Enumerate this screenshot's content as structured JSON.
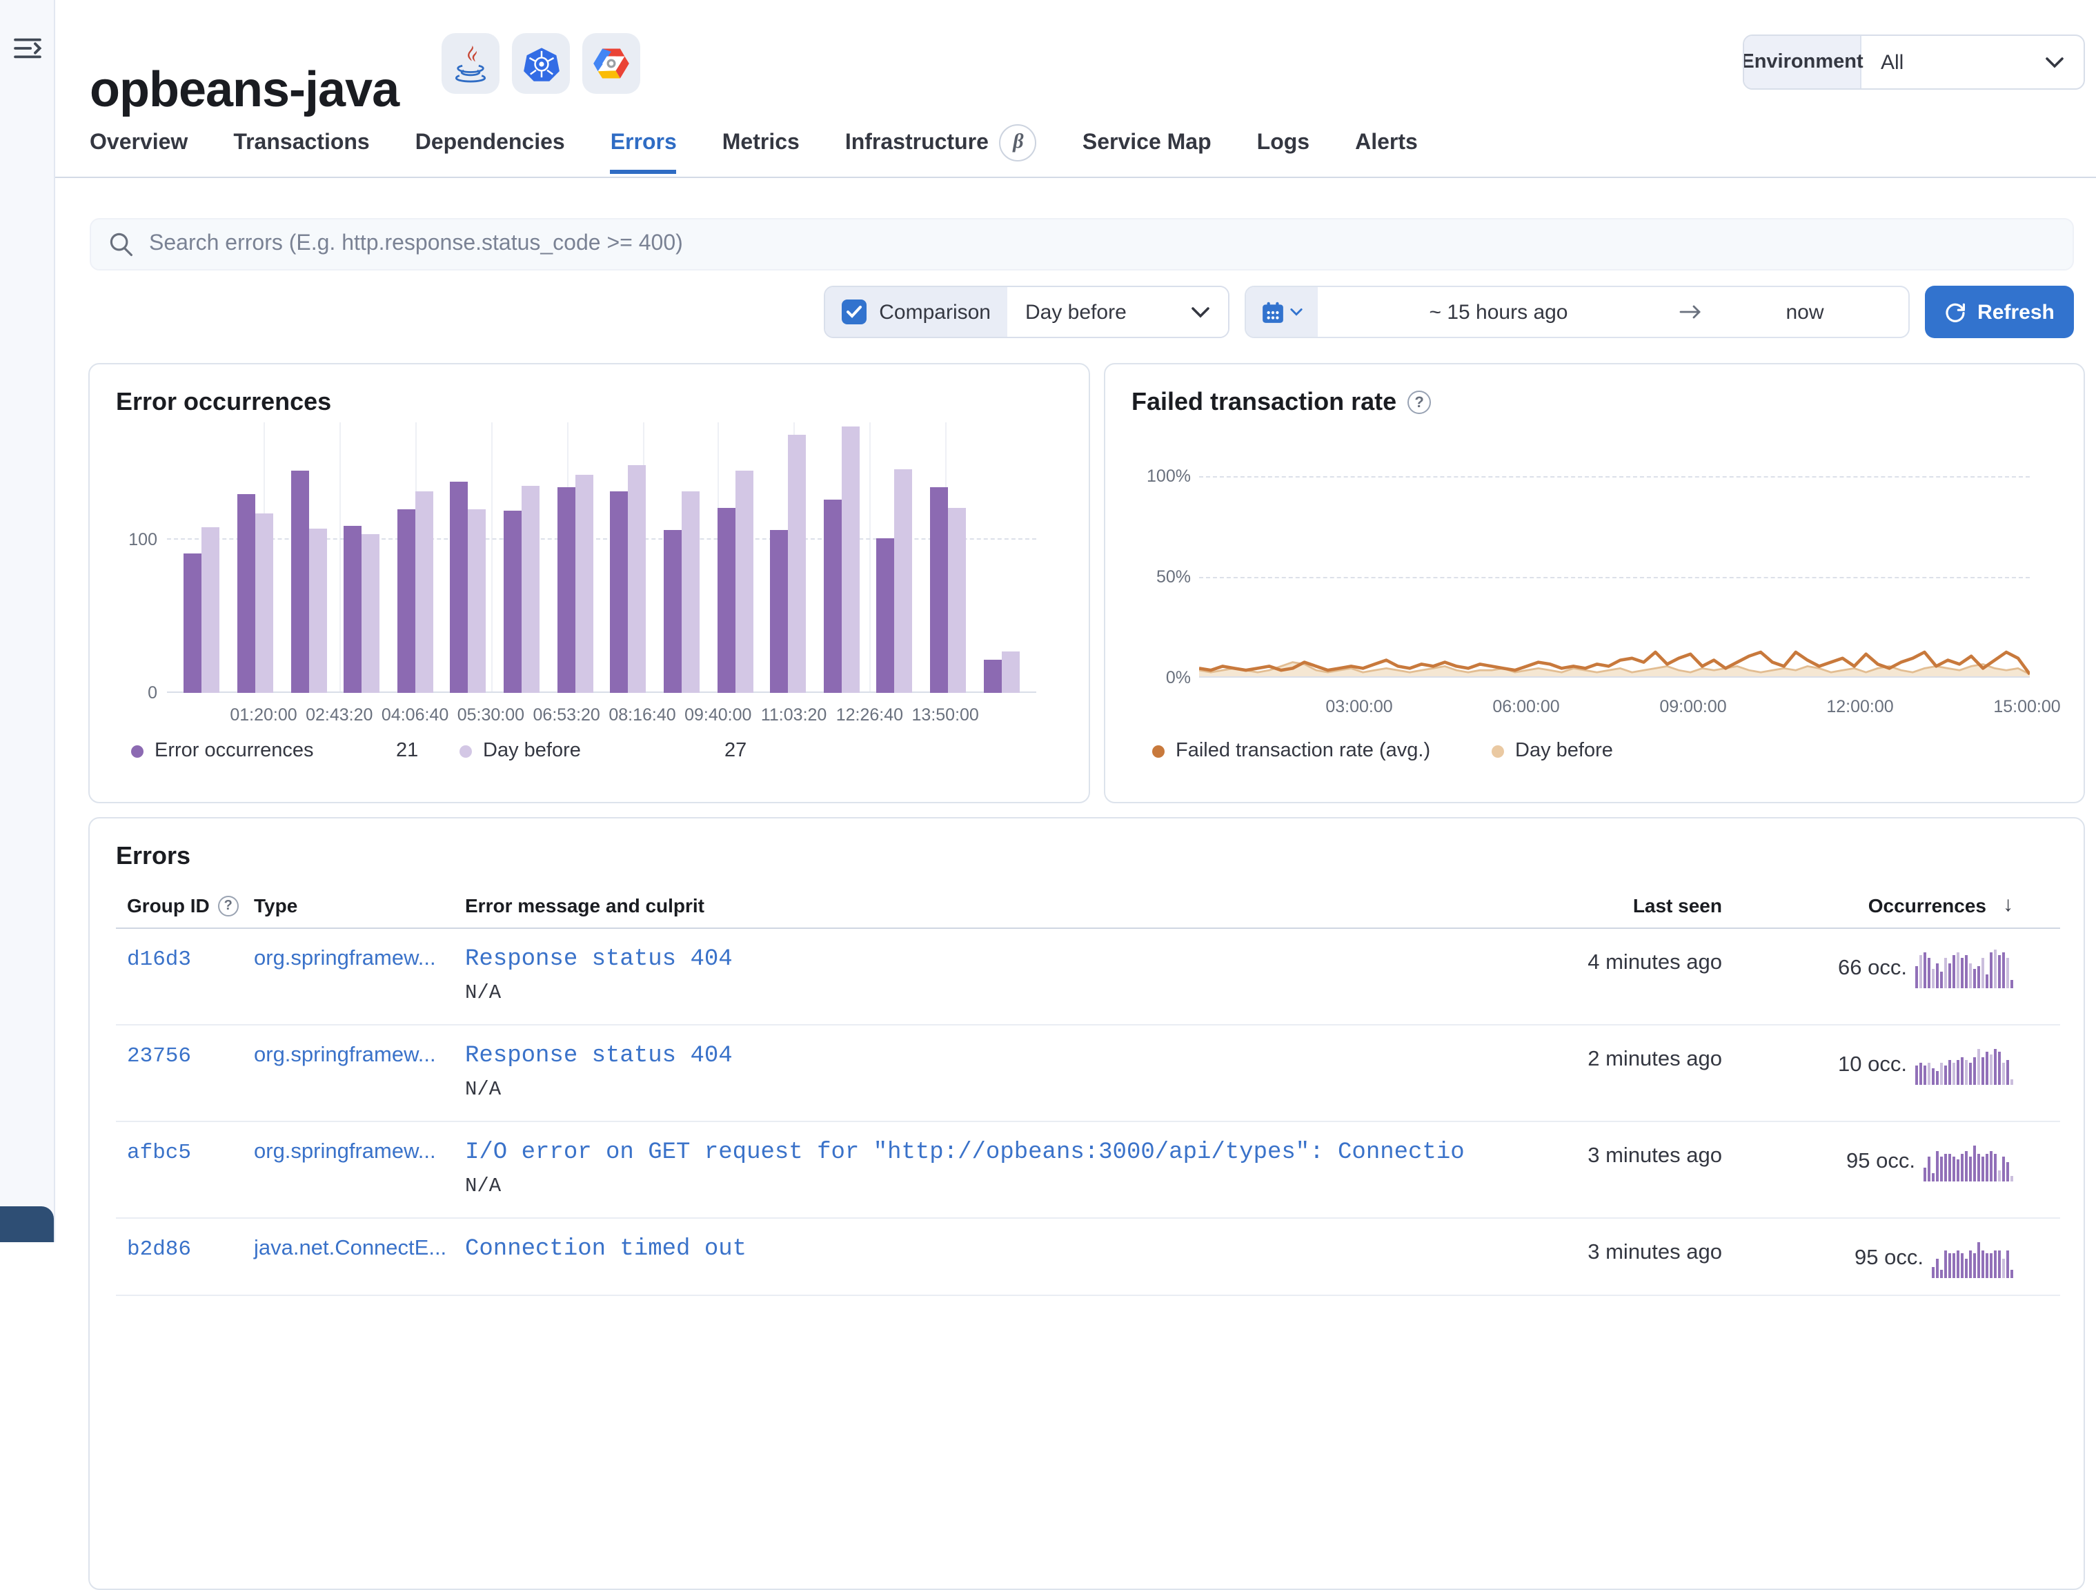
{
  "nav": {
    "menu_tooltip": "Toggle primary navigation"
  },
  "header": {
    "service_name": "opbeans-java",
    "tech_badges": [
      "java",
      "kubernetes",
      "google-cloud"
    ],
    "environment_label": "Environment",
    "environment_value": "All"
  },
  "tabs": {
    "items": [
      "Overview",
      "Transactions",
      "Dependencies",
      "Errors",
      "Metrics",
      "Infrastructure",
      "Service Map",
      "Logs",
      "Alerts"
    ],
    "selected": "Errors",
    "beta_tab": "Infrastructure",
    "beta_glyph": "β"
  },
  "search": {
    "placeholder": "Search errors (E.g. http.response.status_code >= 400)"
  },
  "controls": {
    "comparison_label": "Comparison",
    "comparison_checked": true,
    "comparison_value": "Day before",
    "time_start": "~ 15 hours ago",
    "time_end": "now",
    "refresh_label": "Refresh"
  },
  "colors": {
    "accent_blue": "#3273ce",
    "tab_blue": "#2f6cc4",
    "link_blue": "#3a72c9",
    "bar_current": "#8c6ab2",
    "bar_before": "#d3c7e5",
    "line_current": "#c8793c",
    "line_before": "#e2bd92",
    "area_before": "#f1ddc0",
    "spark_dark": "#9170b8",
    "spark_light": "#cbbedd"
  },
  "chart_data": [
    {
      "type": "bar",
      "title": "Error occurrences",
      "categories_ticks": [
        "01:20:00",
        "02:43:20",
        "04:06:40",
        "05:30:00",
        "06:53:20",
        "08:16:40",
        "09:40:00",
        "11:03:20",
        "12:26:40",
        "13:50:00"
      ],
      "series": [
        {
          "name": "Error occurrences",
          "current_value": "21",
          "values": [
            90,
            129,
            144,
            108,
            119,
            137,
            118,
            133,
            130,
            105,
            120,
            105,
            125,
            100,
            133,
            21
          ]
        },
        {
          "name": "Day before",
          "current_value": "27",
          "values": [
            107,
            116,
            106,
            103,
            130,
            119,
            134,
            141,
            147,
            130,
            144,
            167,
            172,
            145,
            120,
            27
          ]
        }
      ],
      "ylabels": [
        "100",
        "0"
      ],
      "ylim": [
        0,
        180
      ],
      "grid": "horizontal-dashed-at-100, vertical-at-ticks",
      "legend_position": "bottom"
    },
    {
      "type": "line",
      "title": "Failed transaction rate",
      "x_ticks": [
        "03:00:00",
        "06:00:00",
        "09:00:00",
        "12:00:00",
        "15:00:00"
      ],
      "ylabels": [
        "100%",
        "50%",
        "0%"
      ],
      "ylim": [
        0,
        100
      ],
      "legend_position": "bottom",
      "series": [
        {
          "name": "Failed transaction rate (avg.)",
          "values": [
            4,
            3,
            5,
            4,
            3,
            4,
            5,
            3,
            4,
            7,
            5,
            3,
            4,
            5,
            4,
            6,
            8,
            5,
            4,
            6,
            5,
            7,
            5,
            4,
            6,
            5,
            4,
            3,
            5,
            7,
            6,
            4,
            5,
            4,
            6,
            5,
            8,
            9,
            7,
            12,
            6,
            9,
            11,
            5,
            8,
            4,
            7,
            10,
            12,
            7,
            5,
            12,
            8,
            5,
            7,
            9,
            5,
            11,
            6,
            4,
            7,
            9,
            12,
            5,
            8,
            6,
            10,
            4,
            8,
            12,
            9,
            1
          ]
        },
        {
          "name": "Day before",
          "style": "area",
          "values": [
            3,
            2,
            3,
            4,
            3,
            2,
            3,
            5,
            7,
            6,
            3,
            2,
            3,
            4,
            2,
            3,
            4,
            3,
            2,
            3,
            4,
            5,
            3,
            2,
            3,
            3,
            4,
            2,
            3,
            4,
            3,
            2,
            4,
            3,
            2,
            3,
            4,
            2,
            3,
            4,
            5,
            3,
            2,
            4,
            3,
            4,
            5,
            3,
            2,
            3,
            4,
            3,
            5,
            4,
            2,
            3,
            4,
            2,
            4,
            5,
            3,
            2,
            4,
            5,
            4,
            3,
            5,
            6,
            4,
            3,
            4,
            1
          ]
        }
      ],
      "annotation_band": "right-edge"
    }
  ],
  "errors_table": {
    "title": "Errors",
    "columns": {
      "group_id": "Group ID",
      "type": "Type",
      "message": "Error message and culprit",
      "last_seen": "Last seen",
      "occurrences": "Occurrences",
      "sort_icon": "↓"
    },
    "rows": [
      {
        "group_id": "d16d3",
        "type": "org.springframew...",
        "message": "Response status 404",
        "culprit": "N/A",
        "last_seen": "4 minutes ago",
        "occurrences": "66 occ.",
        "spark": {
          "values": [
            8,
            12,
            13,
            11,
            7,
            9,
            6,
            11,
            9,
            12,
            13,
            11,
            12,
            9,
            7,
            8,
            11,
            5,
            13,
            14,
            12,
            13,
            11,
            3
          ],
          "light": [
            1,
            4,
            7,
            10,
            13,
            16,
            19,
            22
          ]
        }
      },
      {
        "group_id": "23756",
        "type": "org.springframew...",
        "message": "Response status 404",
        "culprit": "N/A",
        "last_seen": "2 minutes ago",
        "occurrences": "10 occ.",
        "spark": {
          "values": [
            7,
            8,
            7,
            8,
            6,
            5,
            8,
            7,
            9,
            8,
            9,
            10,
            9,
            8,
            10,
            13,
            10,
            12,
            11,
            13,
            12,
            8,
            9,
            2
          ],
          "light": [
            3,
            6,
            9,
            12,
            15,
            18,
            21,
            23
          ]
        }
      },
      {
        "group_id": "afbc5",
        "type": "org.springframew...",
        "message": "I/O error on GET request for \"http://opbeans:3000/api/types\": Connectio",
        "culprit": "N/A",
        "last_seen": "3 minutes ago",
        "occurrences": "95 occ.",
        "spark": {
          "values": [
            5,
            9,
            3,
            11,
            9,
            10,
            10,
            9,
            8,
            10,
            11,
            9,
            13,
            10,
            9,
            10,
            11,
            10,
            4,
            9,
            7,
            2
          ],
          "light": [
            18,
            21
          ]
        }
      },
      {
        "group_id": "b2d86",
        "type": "java.net.ConnectE...",
        "message": "Connection timed out",
        "culprit": "",
        "last_seen": "3 minutes ago",
        "occurrences": "95 occ.",
        "spark": {
          "values": [
            4,
            7,
            3,
            10,
            9,
            9,
            10,
            9,
            7,
            10,
            9,
            13,
            10,
            9,
            9,
            10,
            10,
            7,
            10,
            3
          ],
          "light": [
            17
          ]
        }
      }
    ]
  }
}
